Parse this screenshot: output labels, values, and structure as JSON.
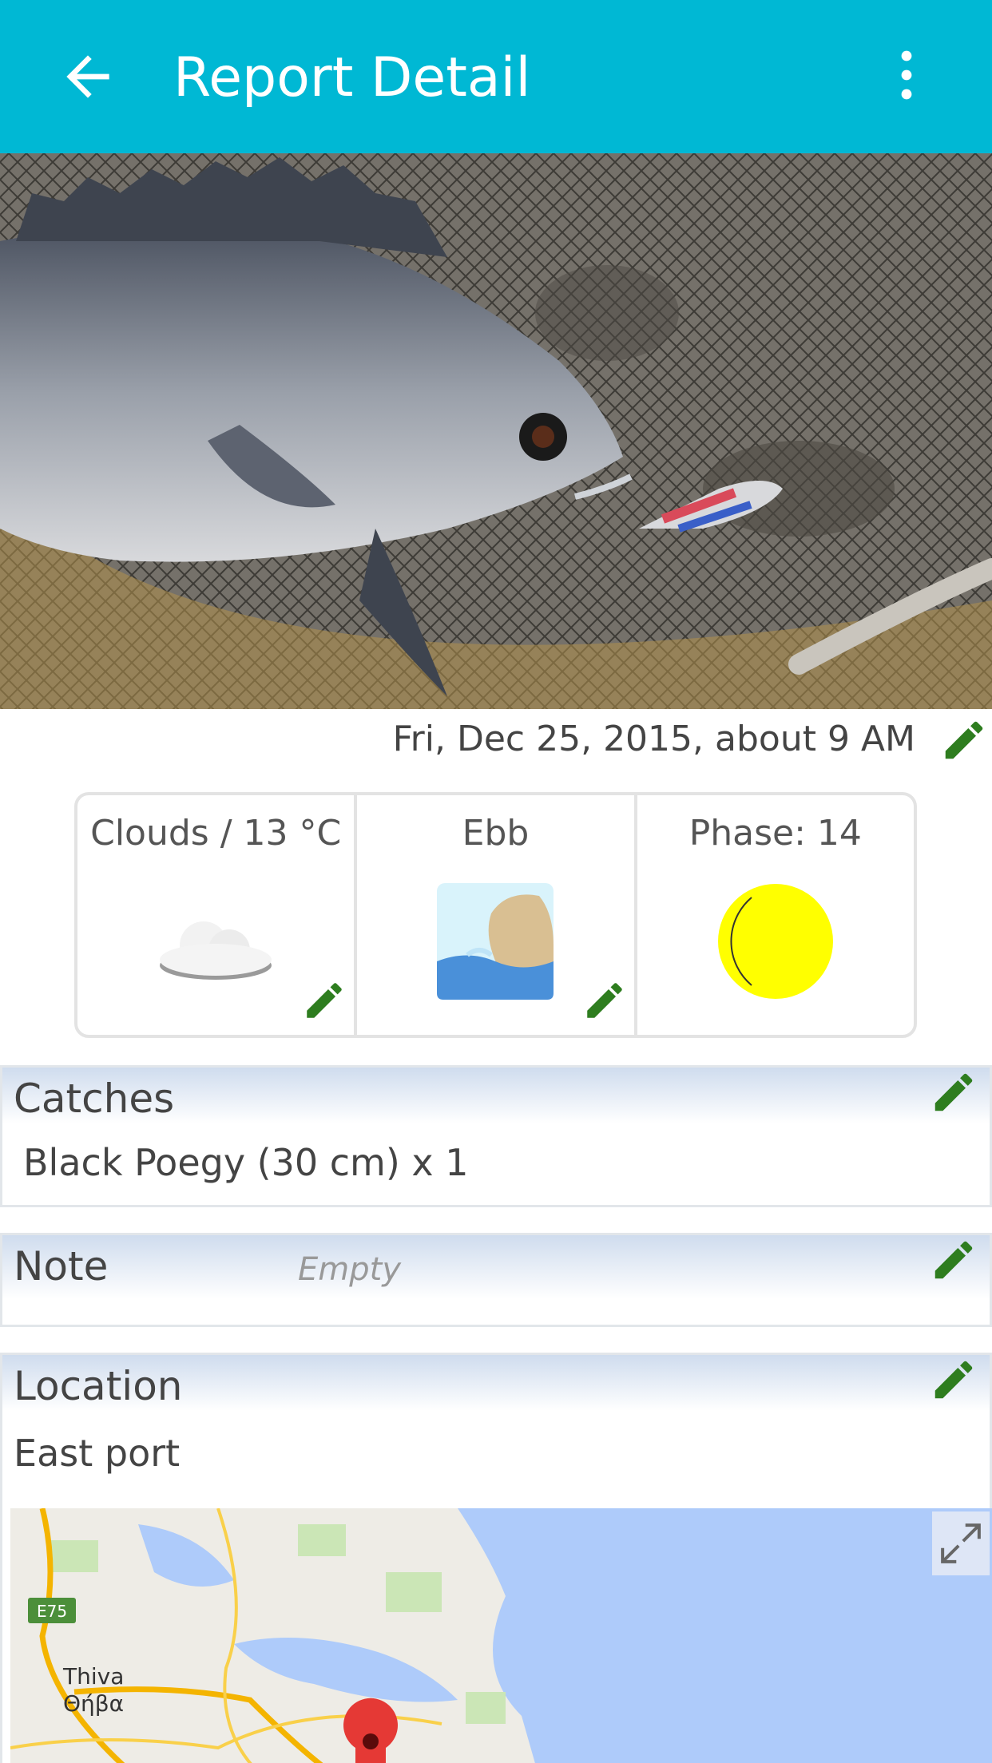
{
  "app_bar": {
    "title": "Report Detail",
    "back_icon": "arrow-back-icon",
    "menu_icon": "more-vert-icon",
    "background_color": "#00b8d4"
  },
  "report": {
    "date": "Fri, Dec 25, 2015, about 9 AM",
    "conditions": {
      "weather": {
        "label": "Clouds / 13 °C",
        "icon": "cloud-icon"
      },
      "tide": {
        "label": "Ebb",
        "icon": "ebb-tide-icon"
      },
      "moon": {
        "label": "Phase: 14",
        "icon": "moon-phase-icon",
        "color": "#ffff00"
      }
    },
    "catches": {
      "title": "Catches",
      "items": [
        "Black Poegy (30 cm) x 1"
      ]
    },
    "note": {
      "title": "Note",
      "placeholder": "Empty"
    },
    "location": {
      "title": "Location",
      "name": "East port",
      "map_labels": {
        "road": "E75",
        "city_latin": "Thiva",
        "city_greek": "Θήβα"
      }
    }
  },
  "colors": {
    "edit_icon": "#2e7d1f",
    "section_header": "#cfdcee"
  }
}
